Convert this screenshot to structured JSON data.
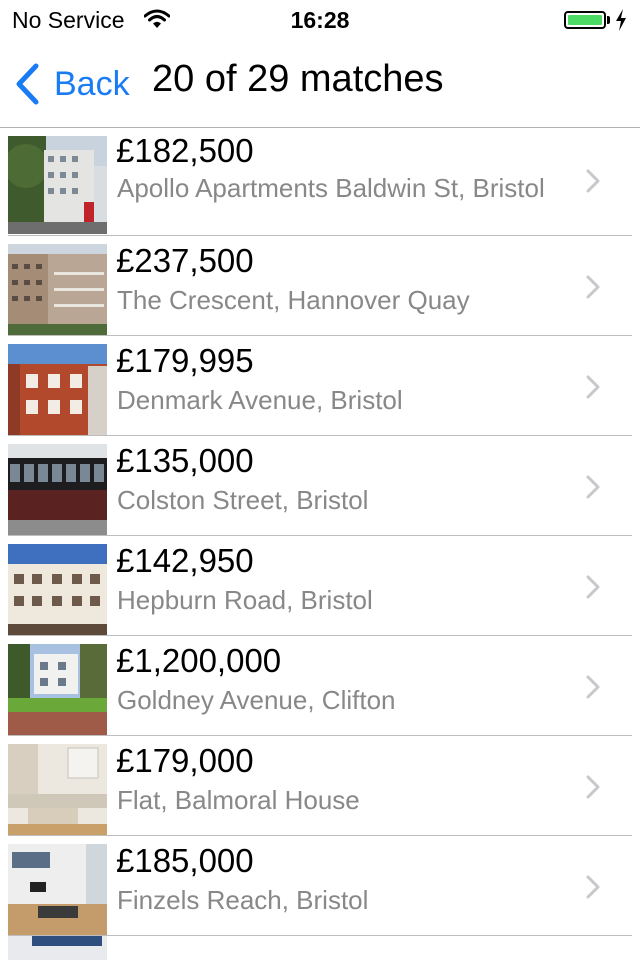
{
  "status_bar": {
    "carrier": "No Service",
    "time": "16:28",
    "battery_color": "#4cd964"
  },
  "nav": {
    "back_label": "Back",
    "title": "20 of 29 matches",
    "accent_color": "#1a7cf5"
  },
  "listings": [
    {
      "price": "£182,500",
      "address": "Apollo Apartments Baldwin St, Bristol"
    },
    {
      "price": "£237,500",
      "address": "The Crescent, Hannover Quay"
    },
    {
      "price": "£179,995",
      "address": "Denmark Avenue, Bristol"
    },
    {
      "price": "£135,000",
      "address": "Colston Street, Bristol"
    },
    {
      "price": "£142,950",
      "address": "Hepburn Road, Bristol"
    },
    {
      "price": "£1,200,000",
      "address": "Goldney Avenue, Clifton"
    },
    {
      "price": "£179,000",
      "address": "Flat, Balmoral House"
    },
    {
      "price": "£185,000",
      "address": "Finzels Reach, Bristol"
    }
  ]
}
